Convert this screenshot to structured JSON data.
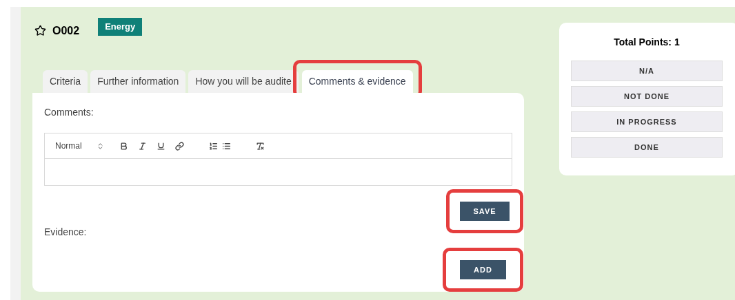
{
  "item": {
    "code": "O002",
    "starred": false,
    "category": "Energy"
  },
  "tabs": [
    {
      "label": "Criteria",
      "selected": false
    },
    {
      "label": "Further information",
      "selected": false
    },
    {
      "label": "How you will be audite",
      "selected": false
    },
    {
      "label": "Comments & evidence",
      "selected": true,
      "highlighted": true
    }
  ],
  "comments": {
    "label": "Comments:",
    "style_select": "Normal",
    "save_button": "SAVE",
    "save_highlighted": true
  },
  "evidence": {
    "label": "Evidence:",
    "add_button": "ADD",
    "add_highlighted": true
  },
  "points": {
    "title": "Total Points: 1",
    "statuses": [
      "N/A",
      "NOT DONE",
      "IN PROGRESS",
      "DONE"
    ]
  }
}
